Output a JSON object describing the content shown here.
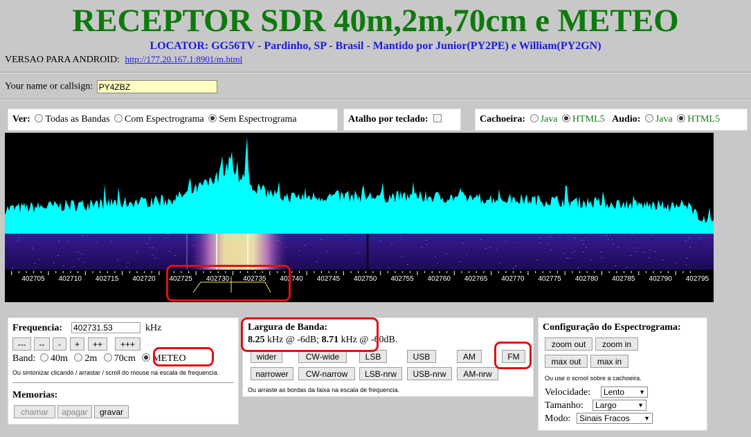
{
  "header": {
    "title": "RECEPTOR SDR 40m,2m,70cm e METEO",
    "locator": "LOCATOR: GG56TV - Pardinho, SP - Brasil - Mantido por Junior(PY2PE) e William(PY2GN)",
    "android_label": "VERSAO PARA ANDROID:",
    "android_link": "http://177.20.167.1:8901/m.html"
  },
  "callsign": {
    "label": "Your name or callsign:",
    "value": "PY4ZBZ"
  },
  "view_panel": {
    "label": "Ver:",
    "options": [
      "Todas as Bandas",
      "Com Espectrograma",
      "Sem Espectrograma"
    ],
    "selected": "Sem Espectrograma"
  },
  "shortcut_panel": {
    "label": "Atalho por teclado:"
  },
  "cascade_panel": {
    "waterfall_label": "Cachoeira:",
    "waterfall_options": [
      "Java",
      "HTML5"
    ],
    "audio_label": "Audio:",
    "audio_options": [
      "Java",
      "HTML5"
    ]
  },
  "spectrum": {
    "freq_ticks": [
      "402705",
      "402710",
      "402715",
      "402720",
      "402725",
      "402730",
      "402735",
      "402740",
      "402745",
      "402750",
      "402755",
      "402760",
      "402765",
      "402770",
      "402775",
      "402780",
      "402785",
      "402790",
      "402795"
    ],
    "colors": {
      "spectrum": "#00ffff",
      "waterfall_bg": "#2a1070",
      "signal": "#f8f0a0",
      "highlight": "#e01010"
    }
  },
  "frequency_panel": {
    "label": "Frequencia:",
    "value": "402731.53",
    "unit": "kHz",
    "step_buttons": [
      "---",
      "--",
      "-",
      "+",
      "++",
      "+++"
    ],
    "band_label": "Band:",
    "bands": [
      "40m",
      "2m",
      "70cm",
      "METEO"
    ],
    "selected_band": "METEO",
    "hint": "Ou sintonizar clicando / arrastar / scroll do mouse na escala de frequencia.",
    "memories_label": "Memorias:",
    "memory_buttons": [
      "chamar",
      "apagar",
      "gravar"
    ]
  },
  "bandwidth_panel": {
    "label": "Largura de Banda:",
    "bw1": "8.25",
    "bw1_suffix": " kHz @ -6dB; ",
    "bw2": "8.71",
    "bw2_suffix": " kHz @ -60dB.",
    "mode_row1": [
      "wider",
      "CW-wide",
      "LSB",
      "USB",
      "AM",
      "FM"
    ],
    "mode_row2": [
      "narrower",
      "CW-narrow",
      "LSB-nrw",
      "USB-nrw",
      "AM-nrw"
    ],
    "hint": "Ou arraste as bordas da faixa na escala de frequencia."
  },
  "spectro_config_panel": {
    "label": "Configuração do Espectrograma:",
    "buttons": [
      "zoom out",
      "zoom in",
      "max out",
      "max in"
    ],
    "hint": "Ou use o scrool sobre a cachoeira.",
    "speed_label": "Velocidade:",
    "speed_value": "Lento",
    "size_label": "Tamanho:",
    "size_value": "Largo",
    "mode_label": "Modo:",
    "mode_value": "Sinais Fracos"
  }
}
